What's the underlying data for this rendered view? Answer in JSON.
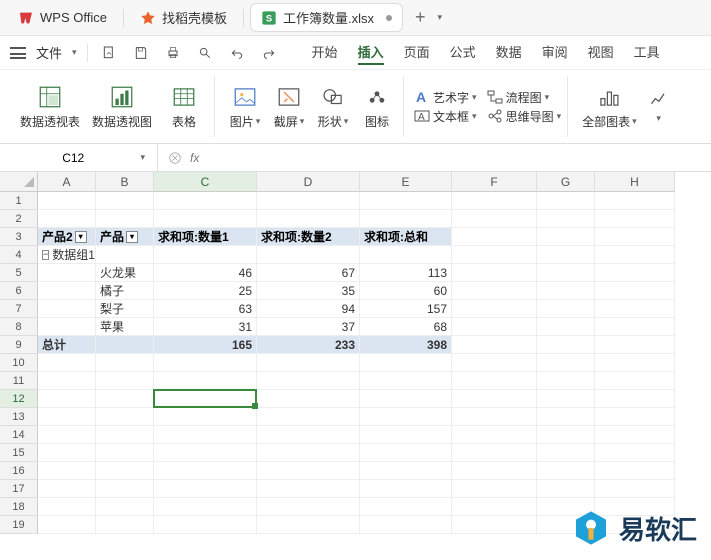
{
  "titlebar": {
    "app_name": "WPS Office",
    "template_tab": "找稻壳模板",
    "file_tab": "工作簿数量.xlsx",
    "plus": "+"
  },
  "quick": {
    "file_menu": "文件"
  },
  "menu": {
    "start": "开始",
    "insert": "插入",
    "page": "页面",
    "formula": "公式",
    "data": "数据",
    "review": "审阅",
    "view": "视图",
    "tool": "工具"
  },
  "ribbon": {
    "pivot_table": "数据透视表",
    "pivot_chart": "数据透视图",
    "table": "表格",
    "picture": "图片",
    "screenshot": "截屏",
    "shape": "形状",
    "icon": "图标",
    "wordart": "艺术字",
    "textbox": "文本框",
    "flowchart": "流程图",
    "mindmap": "思维导图",
    "allcharts": "全部图表"
  },
  "formula_bar": {
    "cell_ref": "C12",
    "fx": "fx"
  },
  "columns": [
    "A",
    "B",
    "C",
    "D",
    "E",
    "F",
    "G",
    "H"
  ],
  "rows": [
    "1",
    "2",
    "3",
    "4",
    "5",
    "6",
    "7",
    "8",
    "9",
    "10",
    "11",
    "12",
    "13",
    "14",
    "15",
    "16",
    "17",
    "18",
    "19"
  ],
  "pivot": {
    "hdr_product2": "产品2",
    "hdr_product": "产品",
    "hdr_qty1": "求和项:数量1",
    "hdr_qty2": "求和项:数量2",
    "hdr_total": "求和项:总和",
    "group_label": "数据组1",
    "rows": [
      {
        "name": "火龙果",
        "q1": "46",
        "q2": "67",
        "t": "113"
      },
      {
        "name": "橘子",
        "q1": "25",
        "q2": "35",
        "t": "60"
      },
      {
        "name": "梨子",
        "q1": "63",
        "q2": "94",
        "t": "157"
      },
      {
        "name": "苹果",
        "q1": "31",
        "q2": "37",
        "t": "68"
      }
    ],
    "total_label": "总计",
    "total_q1": "165",
    "total_q2": "233",
    "total_t": "398"
  },
  "watermark": "易软汇",
  "selected_cell": "C12"
}
